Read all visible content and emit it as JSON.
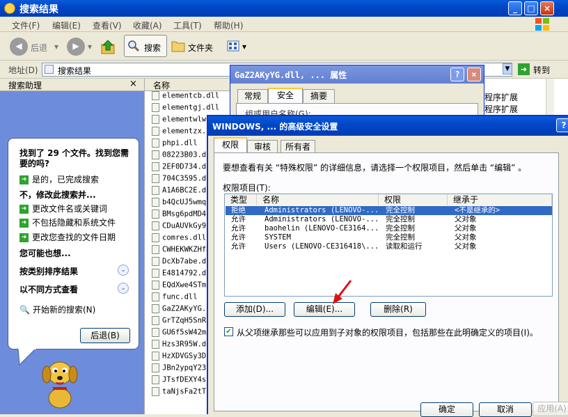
{
  "window": {
    "title": "搜索结果"
  },
  "menu": [
    "文件(F)",
    "编辑(E)",
    "查看(V)",
    "收藏(A)",
    "工具(T)",
    "帮助(H)"
  ],
  "toolbar": {
    "back": "后退",
    "search": "搜索",
    "folders": "文件夹"
  },
  "address": {
    "label": "地址(D)",
    "value": "搜索结果",
    "go": "转到"
  },
  "search_panel": {
    "title": "搜索助理",
    "found": "找到了 29 个文件。找到您需要的吗?",
    "yes_done": "是的，已完成搜索",
    "refine_heading": "不，修改此搜索并...",
    "options": [
      "更改文件名或关键词",
      "不包括隐藏和系统文件",
      "更改您查找的文件日期"
    ],
    "maybe": "您可能也想...",
    "sort": "按类别排序结果",
    "view_diff": "以不同方式查看",
    "new_search": "开始新的搜索(N)",
    "back_button": "后退(B)"
  },
  "file_list": {
    "header": "名称",
    "items": [
      "elementcb.dll",
      "elementgj.dll",
      "elementwlw.dll",
      "elementzx.dll",
      "phpi.dll",
      "08223B03.dll",
      "2EF0D734.dll",
      "704C3595.dll",
      "A1A6BC2E.dll",
      "b4QcUJ5wmqb.dll",
      "BMsg6pdMD4b.dll",
      "CDuAUVkGy9.dll",
      "comres.dll",
      "CWHEKWKZHf4.dll",
      "DcXb7abe.dll",
      "E4814792.dll",
      "EQdXwe4STm.dll",
      "func.dll",
      "GaZ2AKyYG.dll",
      "GrTZqH5SnRb.dll",
      "GU6f5sW42mc.dll",
      "Hzs3R95W.dll",
      "HzXDVGSy3D.dll",
      "JBn2ypqY23v.dll",
      "JTsfDEXY4s.dll",
      "taNjsFa2tT2.dll"
    ]
  },
  "bg_right": [
    "程序扩展",
    "程序扩展"
  ],
  "props_dialog": {
    "title": "GaZ2AKyYG.dll, ... 属性",
    "tabs": [
      "常规",
      "安全",
      "摘要"
    ],
    "hidden_label": "组或用户名称(G):"
  },
  "security_dialog": {
    "title": "WINDOWS, ... 的高级安全设置",
    "tabs": [
      "权限",
      "审核",
      "所有者"
    ],
    "intro": "要想查看有关 “特殊权限” 的详细信息，请选择一个权限项目，然后单击 “编辑” 。",
    "entries_label": "权限项目(T):",
    "columns": [
      "类型",
      "名称",
      "权限",
      "继承于"
    ],
    "rows": [
      {
        "type": "拒绝",
        "name": "Administrators (LENOVO-...",
        "perm": "完全控制",
        "inherit": "<不是继承的>"
      },
      {
        "type": "允许",
        "name": "Administrators (LENOVO-...",
        "perm": "完全控制",
        "inherit": "父对象"
      },
      {
        "type": "允许",
        "name": "baohelin (LENOVO-CE3164...",
        "perm": "完全控制",
        "inherit": "父对象"
      },
      {
        "type": "允许",
        "name": "SYSTEM",
        "perm": "完全控制",
        "inherit": "父对象"
      },
      {
        "type": "允许",
        "name": "Users (LENOVO-CE316418\\...",
        "perm": "读取和运行",
        "inherit": "父对象"
      }
    ],
    "add": "添加(D)...",
    "edit": "编辑(E)...",
    "remove": "删除(R)",
    "inherit_check": "从父项继承那些可以应用到子对象的权限项目，包括那些在此明确定义的项目(I)。",
    "ok": "确定",
    "cancel": "取消",
    "apply": "应用(A)"
  },
  "colors": {
    "selection": "#316ac5",
    "xp_blue": "#0047c8",
    "arrow_red": "#e01010"
  }
}
